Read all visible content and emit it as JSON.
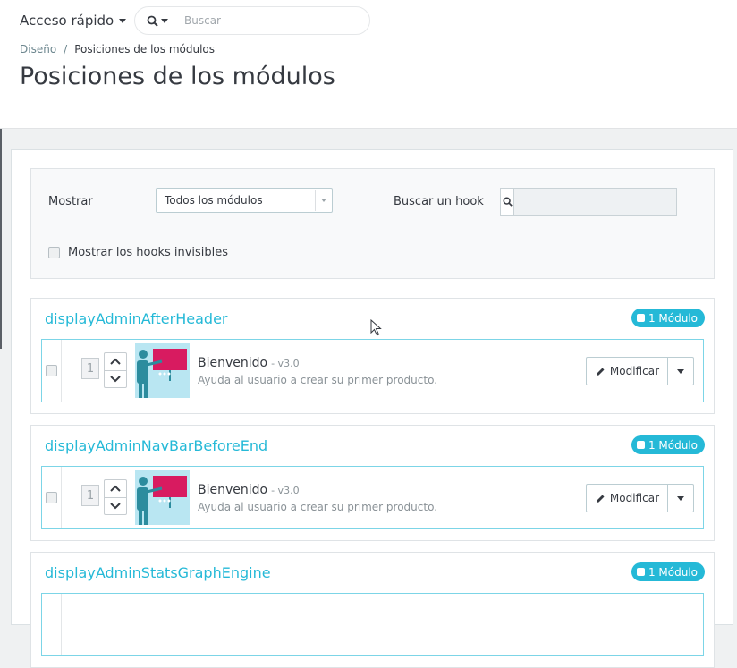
{
  "header": {
    "quick_access": "Acceso rápido",
    "search_placeholder": "Buscar"
  },
  "breadcrumb": {
    "parent": "Diseño",
    "separator": "/",
    "current": "Posiciones de los módulos"
  },
  "page_title": "Posiciones de los módulos",
  "filters": {
    "show_label": "Mostrar",
    "show_value": "Todos los módulos",
    "hook_search_label": "Buscar un hook",
    "hook_search_value": "",
    "invisible_label": "Mostrar los hooks invisibles"
  },
  "hooks": [
    {
      "name": "displayAdminAfterHeader",
      "badge": "1 Módulo",
      "module": {
        "position": "1",
        "name": "Bienvenido",
        "version": "- v3.0",
        "description": "Ayuda al usuario a crear su primer producto.",
        "modify_label": "Modificar"
      }
    },
    {
      "name": "displayAdminNavBarBeforeEnd",
      "badge": "1 Módulo",
      "module": {
        "position": "1",
        "name": "Bienvenido",
        "version": "- v3.0",
        "description": "Ayuda al usuario a crear su primer producto.",
        "modify_label": "Modificar"
      }
    },
    {
      "name": "displayAdminStatsGraphEngine",
      "badge": "1 Módulo"
    }
  ],
  "colors": {
    "accent": "#25b9d7",
    "text": "#363a41",
    "muted": "#8a9297"
  }
}
